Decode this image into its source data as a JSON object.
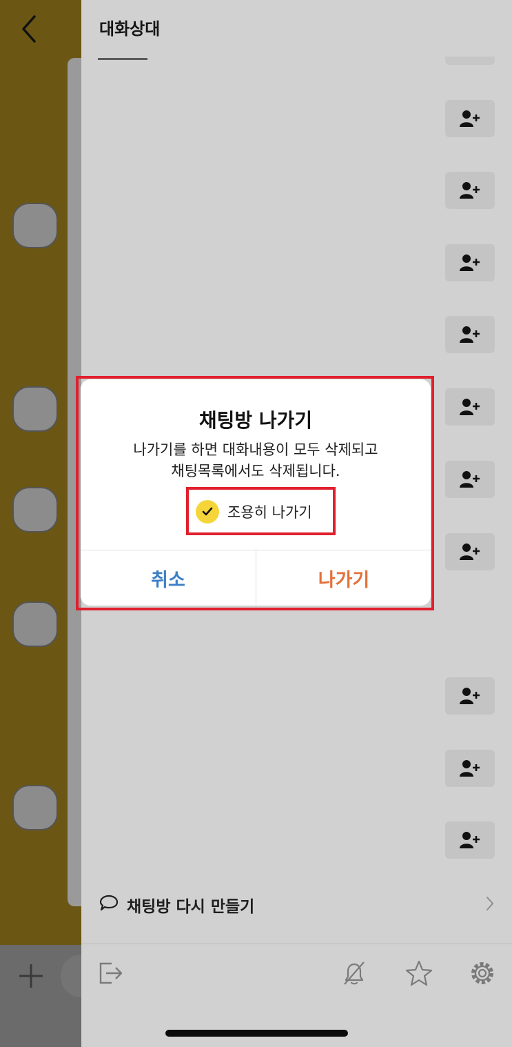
{
  "header": {
    "title": "대화상대"
  },
  "dialog": {
    "title": "채팅방 나가기",
    "message_line1": "나가기를 하면 대화내용이 모두 삭제되고",
    "message_line2": "채팅목록에서도 삭제됩니다.",
    "quiet_leave_label": "조용히 나가기",
    "quiet_leave_checked": true,
    "cancel_label": "취소",
    "leave_label": "나가기"
  },
  "footer": {
    "remake_chat_label": "채팅방 다시 만들기"
  },
  "icons": {
    "back": "chevron-left-icon",
    "add_friend": "person-add-icon",
    "remake": "speech-bubble-icon",
    "exit": "exit-icon",
    "mute": "bell-off-icon",
    "favorite": "star-icon",
    "settings": "gear-icon"
  },
  "colors": {
    "highlight": "#e0202e",
    "cancel": "#3d7fc6",
    "leave": "#e3713a",
    "check": "#f6d53a"
  }
}
